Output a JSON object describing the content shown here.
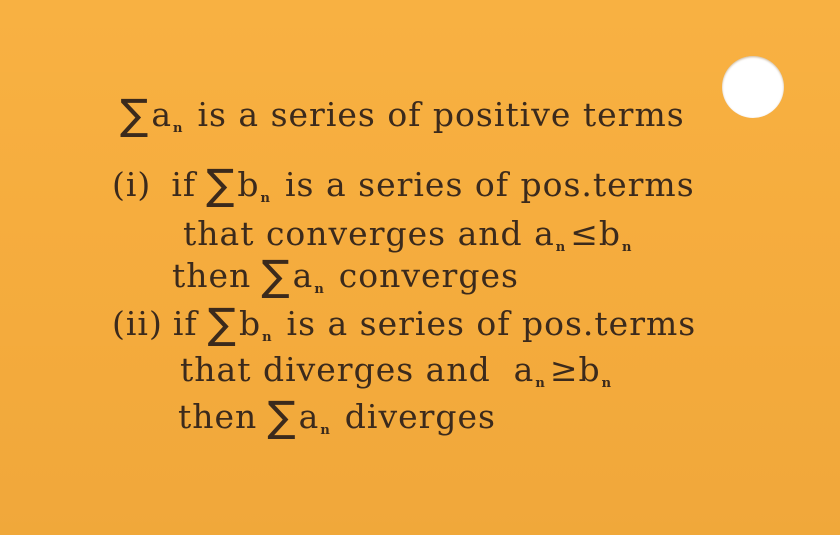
{
  "sigma": "∑",
  "sub_n": "n",
  "line1": {
    "var": "a",
    "text": "is a series of positive terms"
  },
  "line2": {
    "label": "(i)",
    "pre": "if",
    "var": "b",
    "text": "is a series of pos.terms"
  },
  "line3": {
    "pre": "that converges and a",
    "rel": "≤b"
  },
  "line4": {
    "pre": "then",
    "var": "a",
    "text": "converges"
  },
  "line5": {
    "label": "(ii)",
    "pre": "if",
    "var": "b",
    "text": "is a series of pos.terms"
  },
  "line6": {
    "pre": "that diverges and  a",
    "rel": "≥b"
  },
  "line7": {
    "pre": "then",
    "var": "a",
    "text": "diverges"
  }
}
